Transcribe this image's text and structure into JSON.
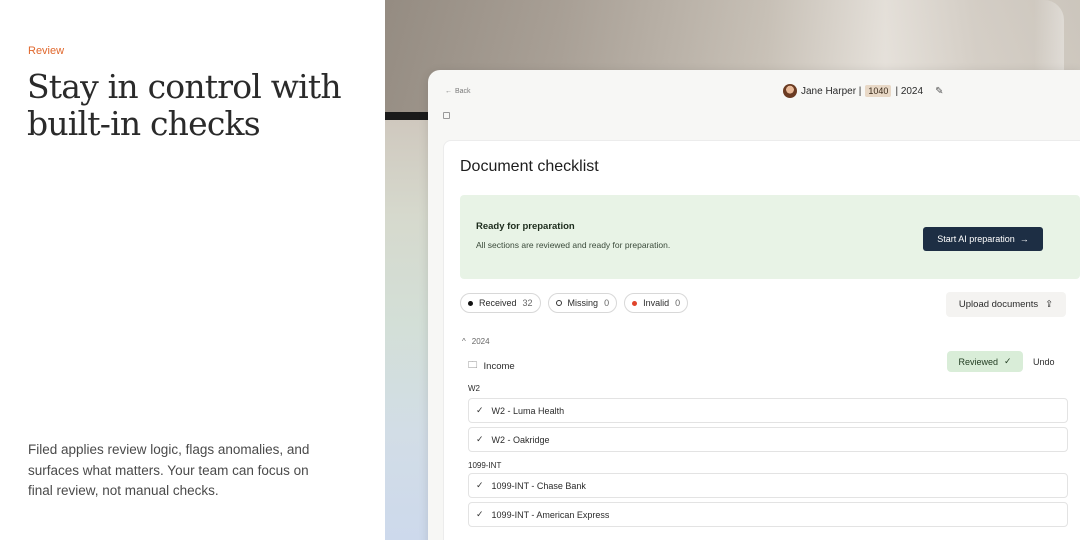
{
  "marketing": {
    "eyebrow": "Review",
    "headline": "Stay in control with built-in checks",
    "blurb": "Filed applies review logic, flags anomalies, and surfaces what matters. Your team can focus on final review, not manual checks."
  },
  "app": {
    "back_label": "Back",
    "client_name": "Jane Harper |",
    "form_badge": "1040",
    "tax_year_label": "| 2024",
    "panel_title": "Document checklist",
    "ready": {
      "title": "Ready for preparation",
      "description": "All sections are reviewed and ready for preparation.",
      "button_label": "Start AI preparation",
      "button_icon": "arrow-right-icon"
    },
    "filters": [
      {
        "label": "Received",
        "count": "32",
        "dot": "black"
      },
      {
        "label": "Missing",
        "count": "0",
        "dot": "hollow"
      },
      {
        "label": "Invalid",
        "count": "0",
        "dot": "red"
      }
    ],
    "upload_label": "Upload documents",
    "year_section": "2024",
    "income_label": "Income",
    "reviewed_label": "Reviewed",
    "undo_label": "Undo",
    "groups": [
      {
        "label": "W2",
        "items": [
          "W2 - Luma Health",
          "W2 - Oakridge"
        ]
      },
      {
        "label": "1099-INT",
        "items": [
          "1099-INT - Chase Bank",
          "1099-INT - American Express"
        ]
      }
    ]
  },
  "colors": {
    "accent": "#e0672c",
    "primary_button": "#1d2e44",
    "ready_bg": "#e8f3e6",
    "reviewed_bg": "#d9edd8",
    "invalid_dot": "#e0442c"
  }
}
